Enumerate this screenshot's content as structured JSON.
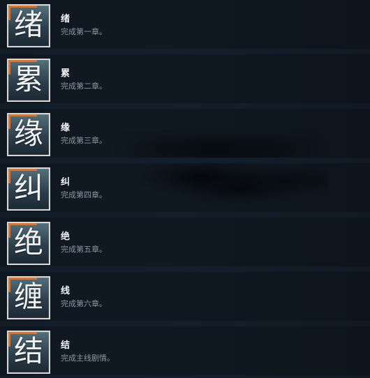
{
  "items": [
    {
      "char": "绪",
      "title": "绪",
      "description": "完成第一章。"
    },
    {
      "char": "累",
      "title": "累",
      "description": "完成第二章。"
    },
    {
      "char": "缘",
      "title": "缘",
      "description": "完成第三章。"
    },
    {
      "char": "纠",
      "title": "纠",
      "description": "完成第四章。"
    },
    {
      "char": "绝",
      "title": "绝",
      "description": "完成第五章。"
    },
    {
      "char": "缠",
      "title": "线",
      "description": "完成第六章。"
    },
    {
      "char": "结",
      "title": "结",
      "description": "完成主线剧情。"
    }
  ]
}
